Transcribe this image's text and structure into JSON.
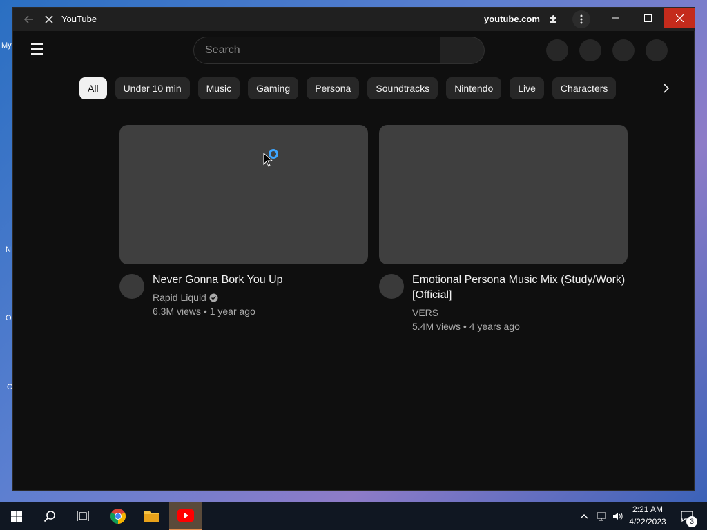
{
  "window": {
    "title": "YouTube",
    "domain": "youtube.com"
  },
  "search": {
    "placeholder": "Search"
  },
  "chips": [
    "All",
    "Under 10 min",
    "Music",
    "Gaming",
    "Persona",
    "Soundtracks",
    "Nintendo",
    "Live",
    "Characters"
  ],
  "videos": [
    {
      "title": "Never Gonna Bork You Up",
      "channel": "Rapid Liquid",
      "verified": true,
      "stats": "6.3M views • 1 year ago"
    },
    {
      "title": "Emotional Persona Music Mix (Study/Work) [Official]",
      "channel": "VERS",
      "verified": false,
      "stats": "5.4M views • 4 years ago"
    }
  ],
  "taskbar": {
    "time": "2:21 AM",
    "date": "4/22/2023",
    "notification_count": "3"
  },
  "desktop_fragments": [
    "My",
    "N",
    "O",
    "C"
  ],
  "colors": {
    "accent_close": "#c42b1c",
    "spinner": "#3ea6ff",
    "background": "#0f0f0f"
  }
}
